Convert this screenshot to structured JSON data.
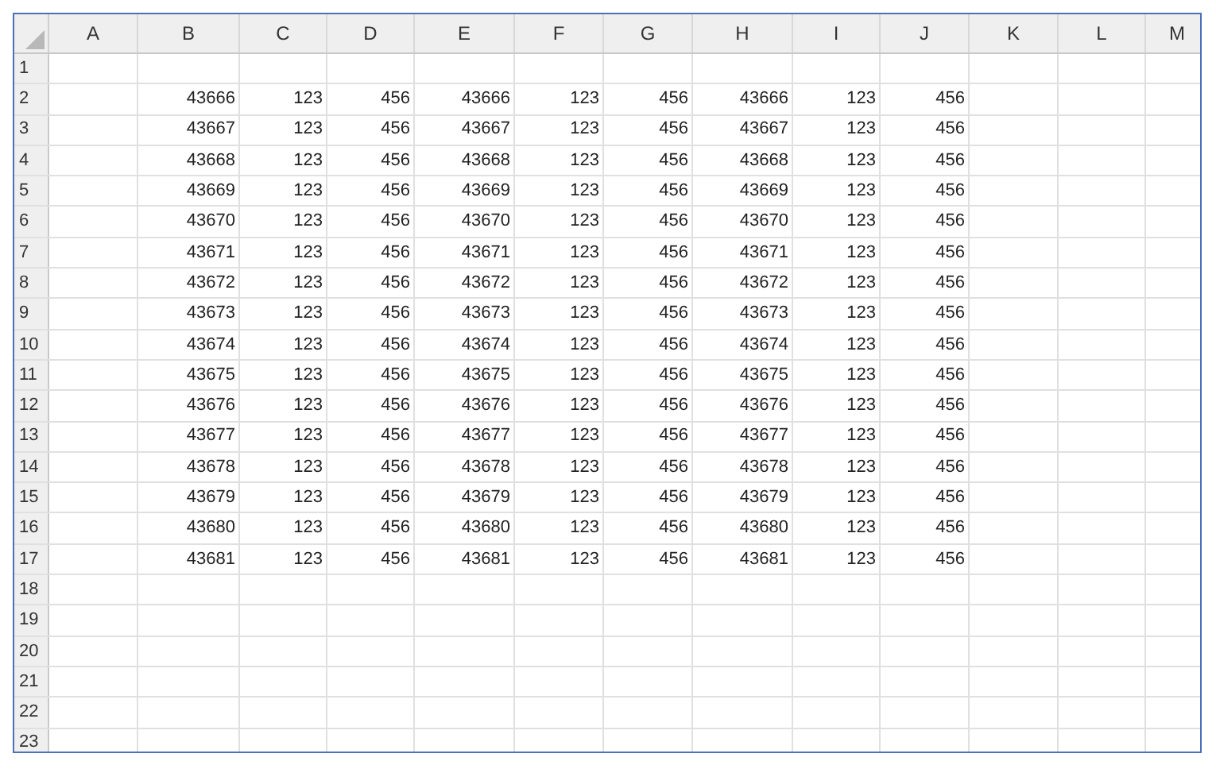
{
  "columns": [
    "A",
    "B",
    "C",
    "D",
    "E",
    "F",
    "G",
    "H",
    "I",
    "J",
    "K",
    "L",
    "M"
  ],
  "rows": [
    {
      "label": "1"
    },
    {
      "label": "2",
      "values": [
        "43666",
        "123",
        "456",
        "43666",
        "123",
        "456",
        "43666",
        "123",
        "456"
      ]
    },
    {
      "label": "3",
      "values": [
        "43667",
        "123",
        "456",
        "43667",
        "123",
        "456",
        "43667",
        "123",
        "456"
      ]
    },
    {
      "label": "4",
      "values": [
        "43668",
        "123",
        "456",
        "43668",
        "123",
        "456",
        "43668",
        "123",
        "456"
      ]
    },
    {
      "label": "5",
      "values": [
        "43669",
        "123",
        "456",
        "43669",
        "123",
        "456",
        "43669",
        "123",
        "456"
      ]
    },
    {
      "label": "6",
      "values": [
        "43670",
        "123",
        "456",
        "43670",
        "123",
        "456",
        "43670",
        "123",
        "456"
      ]
    },
    {
      "label": "7",
      "values": [
        "43671",
        "123",
        "456",
        "43671",
        "123",
        "456",
        "43671",
        "123",
        "456"
      ]
    },
    {
      "label": "8",
      "values": [
        "43672",
        "123",
        "456",
        "43672",
        "123",
        "456",
        "43672",
        "123",
        "456"
      ]
    },
    {
      "label": "9",
      "values": [
        "43673",
        "123",
        "456",
        "43673",
        "123",
        "456",
        "43673",
        "123",
        "456"
      ]
    },
    {
      "label": "10",
      "values": [
        "43674",
        "123",
        "456",
        "43674",
        "123",
        "456",
        "43674",
        "123",
        "456"
      ]
    },
    {
      "label": "11",
      "values": [
        "43675",
        "123",
        "456",
        "43675",
        "123",
        "456",
        "43675",
        "123",
        "456"
      ]
    },
    {
      "label": "12",
      "values": [
        "43676",
        "123",
        "456",
        "43676",
        "123",
        "456",
        "43676",
        "123",
        "456"
      ]
    },
    {
      "label": "13",
      "values": [
        "43677",
        "123",
        "456",
        "43677",
        "123",
        "456",
        "43677",
        "123",
        "456"
      ]
    },
    {
      "label": "14",
      "values": [
        "43678",
        "123",
        "456",
        "43678",
        "123",
        "456",
        "43678",
        "123",
        "456"
      ]
    },
    {
      "label": "15",
      "values": [
        "43679",
        "123",
        "456",
        "43679",
        "123",
        "456",
        "43679",
        "123",
        "456"
      ]
    },
    {
      "label": "16",
      "values": [
        "43680",
        "123",
        "456",
        "43680",
        "123",
        "456",
        "43680",
        "123",
        "456"
      ]
    },
    {
      "label": "17",
      "values": [
        "43681",
        "123",
        "456",
        "43681",
        "123",
        "456",
        "43681",
        "123",
        "456"
      ]
    },
    {
      "label": "18"
    },
    {
      "label": "19"
    },
    {
      "label": "20"
    },
    {
      "label": "21"
    },
    {
      "label": "22"
    },
    {
      "label": "23"
    }
  ]
}
